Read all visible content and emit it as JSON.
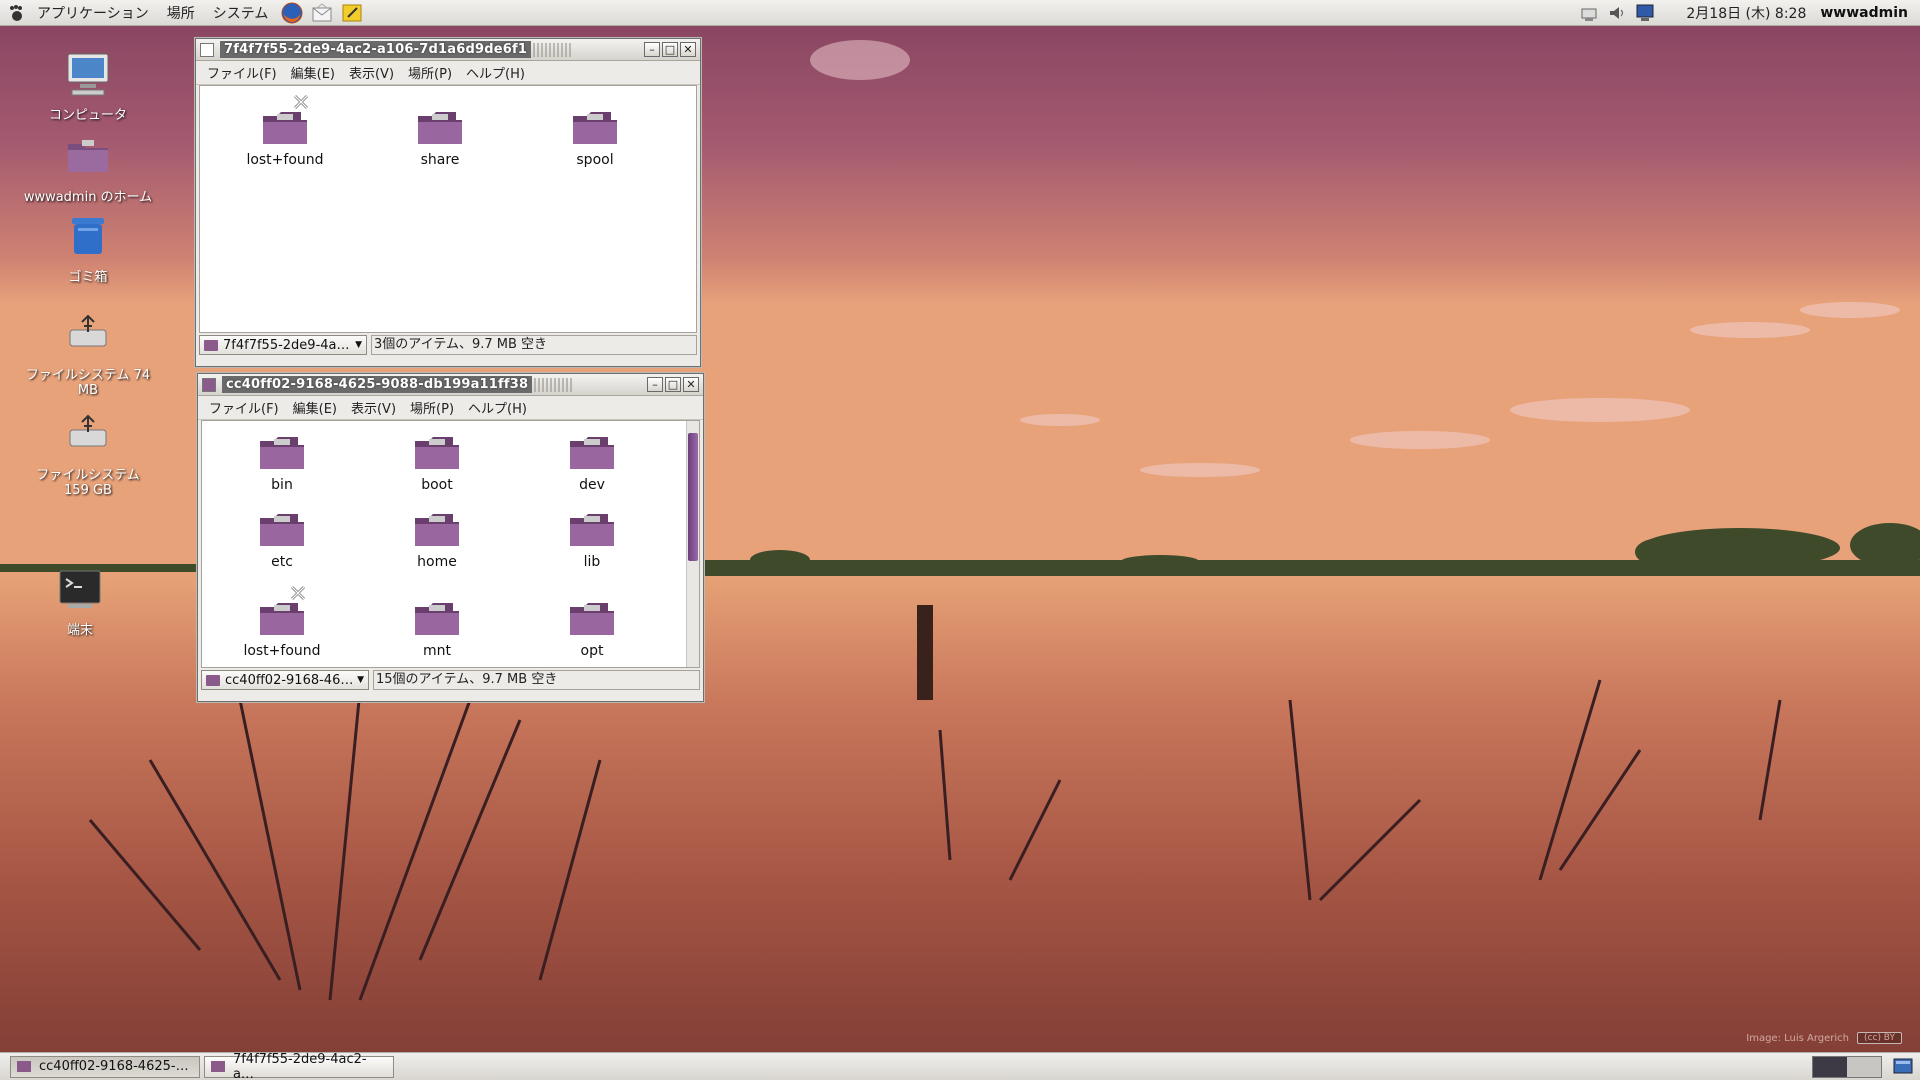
{
  "top_panel": {
    "menus": [
      "アプリケーション",
      "場所",
      "システム"
    ],
    "clock": "2月18日 (木)  8:28",
    "user": "wwwadmin"
  },
  "desktop_icons": [
    {
      "label": "コンピュータ",
      "icon": "computer-icon"
    },
    {
      "label": "wwwadmin のホーム",
      "icon": "home-folder-icon"
    },
    {
      "label": "ゴミ箱",
      "icon": "trash-icon"
    },
    {
      "label": "ファイルシステム 74 MB",
      "icon": "usb-drive-icon"
    },
    {
      "label": "ファイルシステム 159 GB",
      "icon": "usb-drive-icon"
    },
    {
      "label": "端末",
      "icon": "terminal-icon"
    }
  ],
  "window1": {
    "title": "7f4f7f55-2de9-4ac2-a106-7d1a6d9de6f1",
    "menus": [
      "ファイル(F)",
      "編集(E)",
      "表示(V)",
      "場所(P)",
      "ヘルプ(H)"
    ],
    "items": [
      {
        "name": "lost+found",
        "locked": true
      },
      {
        "name": "share",
        "locked": false
      },
      {
        "name": "spool",
        "locked": false
      }
    ],
    "path_combo": "7f4f7f55-2de9-4a…",
    "status": "3個のアイテム、9.7 MB 空き"
  },
  "window2": {
    "title": "cc40ff02-9168-4625-9088-db199a11ff38",
    "menus": [
      "ファイル(F)",
      "編集(E)",
      "表示(V)",
      "場所(P)",
      "ヘルプ(H)"
    ],
    "items": [
      {
        "name": "bin",
        "locked": false
      },
      {
        "name": "boot",
        "locked": false
      },
      {
        "name": "dev",
        "locked": false
      },
      {
        "name": "etc",
        "locked": false
      },
      {
        "name": "home",
        "locked": false
      },
      {
        "name": "lib",
        "locked": false
      },
      {
        "name": "lost+found",
        "locked": true
      },
      {
        "name": "mnt",
        "locked": false
      },
      {
        "name": "opt",
        "locked": false
      }
    ],
    "path_combo": "cc40ff02-9168-46…",
    "status": "15個のアイテム、9.7 MB 空き"
  },
  "taskbar": {
    "tasks": [
      "cc40ff02-9168-4625-…",
      "7f4f7f55-2de9-4ac2-a…"
    ]
  },
  "wallpaper_credit": "Image: Luis Argerich",
  "license_badge": "(cc) BY",
  "colors": {
    "folder": "#8a5a8a",
    "panel": "#e6e4e0",
    "titlebar_title_bg": "#6a6a6a"
  }
}
